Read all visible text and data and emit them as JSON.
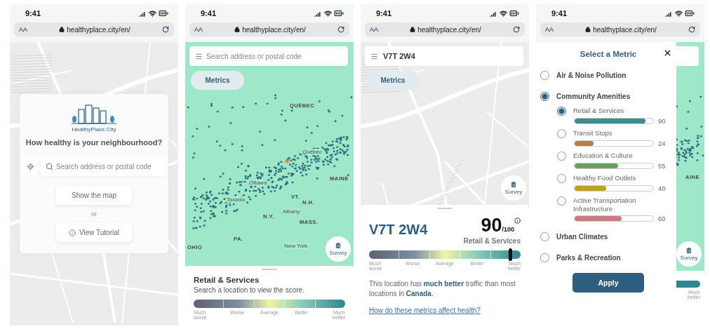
{
  "phones": [
    {
      "kind": "landing",
      "time": "9:41",
      "text_size": "AA",
      "url": "healthyplace.city/en/",
      "logo_text": "HealthyPlace.City",
      "question": "How healthy is your neighbourhood?",
      "search": {
        "placeholder": "Search address or postal code"
      },
      "map_button": "Show the map",
      "separator": "or",
      "tutorial_button": "View Tutorial"
    },
    {
      "kind": "map",
      "time": "9:41",
      "text_size": "AA",
      "url": "healthyplace.city/en/",
      "search": {
        "placeholder": "Search address or postal code"
      },
      "metrics_button": "Metrics",
      "map_labels": [
        "QUÉBEC",
        "Québec",
        "Ottawa",
        "Toronto",
        "MAINE",
        "VT.",
        "N.H.",
        "N.Y.",
        "Albany",
        "MASS.",
        "PA.",
        "OHIO",
        "New York"
      ],
      "survey_button": "Survey",
      "sheet": {
        "title": "Retail & Services",
        "subtitle": "Search a location to view the score.",
        "scale": {
          "labels": [
            "Much worse",
            "Worse",
            "Average",
            "Better",
            "Much better"
          ]
        }
      }
    },
    {
      "kind": "result",
      "time": "9:41",
      "text_size": "AA",
      "url": "healthyplace.city/en/",
      "search": {
        "value": "V7T 2W4"
      },
      "metrics_button": "Metrics",
      "survey_button": "Survey",
      "sheet": {
        "postal_code": "V7T 2W4",
        "score": "90",
        "score_max": "/100",
        "metric": "Retail & Services",
        "scale": {
          "labels": [
            "Much worse",
            "Worse",
            "Average",
            "Better",
            "Much better"
          ],
          "level": 0.93
        },
        "description": "This location has **much better** traffic than most locations in **Canada**.",
        "link": "How do these metrics affect health?"
      }
    },
    {
      "kind": "metrics",
      "time": "9:41",
      "text_size": "AA",
      "url": "healthyplace.city/en/",
      "map_labels": [
        "AINE"
      ],
      "survey_button": "Survey",
      "scale_labels": [
        "Much better"
      ],
      "panel": {
        "title": "Select a Metric",
        "apply_button": "Apply",
        "categories": [
          {
            "label": "Air & Noise Pollution",
            "selected": false
          },
          {
            "label": "Community Amenities",
            "selected": true,
            "children": [
              {
                "label": "Retail & Services",
                "selected": true,
                "level": 0.9,
                "value": "90",
                "color": "#3a8e8f"
              },
              {
                "label": "Transit Stops",
                "selected": false,
                "level": 0.24,
                "value": "24",
                "color": "#c07a3e"
              },
              {
                "label": "Education & Culture",
                "selected": false,
                "level": 0.55,
                "value": "55",
                "color": "#6a9e5e"
              },
              {
                "label": "Healthy Food Outlets",
                "selected": false,
                "level": 0.4,
                "value": "40",
                "color": "#b8a21e"
              },
              {
                "label": "Active Transportation Infrastructure",
                "selected": false,
                "level": 0.6,
                "value": "60",
                "color": "#c08080"
              }
            ]
          },
          {
            "label": "Urban Climates",
            "selected": false
          },
          {
            "label": "Parks & Recreation",
            "selected": false
          }
        ]
      }
    }
  ]
}
